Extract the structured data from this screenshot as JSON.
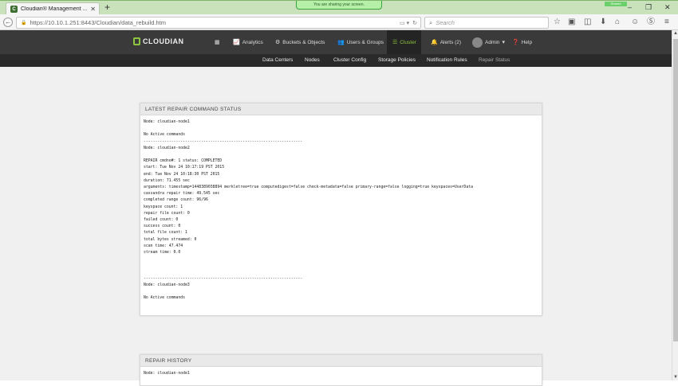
{
  "browser": {
    "tab_title": "Cloudian® Management ...",
    "tab_close": "✕",
    "new_tab": "+",
    "sharing_banner": "You are sharing your screen.",
    "shared_badge": "Shared",
    "url": "https://10.10.1.251:8443/Cloudian/data_rebuild.htm",
    "search_placeholder": "Search",
    "window_controls": [
      "–",
      "❐",
      "✕"
    ]
  },
  "app": {
    "logo": "CLOUDIAN",
    "nav": [
      {
        "label": "",
        "icon": "grid-icon"
      },
      {
        "label": "Analytics",
        "icon": "chart-icon"
      },
      {
        "label": "Buckets & Objects",
        "icon": "gear-icon"
      },
      {
        "label": "Users & Groups",
        "icon": "users-icon"
      },
      {
        "label": "Cluster",
        "icon": "cluster-icon",
        "active": true
      },
      {
        "label": "Alerts (2)",
        "icon": "bell-icon"
      },
      {
        "label": "Admin",
        "icon": "avatar"
      },
      {
        "label": "Help",
        "icon": "help-icon"
      }
    ],
    "subnav": [
      "Data Centers",
      "Nodes",
      "Cluster Config",
      "Storage Policies",
      "Notification Rules",
      "Repair Status"
    ],
    "subnav_active": "Repair Status"
  },
  "panels": {
    "latest": {
      "title": "LATEST REPAIR COMMAND STATUS",
      "lines": [
        "Node: cloudian-node1",
        "",
        "No Active commands",
        "---------------------------------------------------------------------",
        "Node: cloudian-node2",
        "",
        "REPAIR cmdno#: 1 status: COMPLETED",
        "start: Tue Nov 24 10:17:19 PST 2015",
        "end: Tue Nov 24 10:18:30 PST 2015",
        "duration: 71.455 sec",
        "arguments: timestamp=1448389038894 merkletree=true computedigest=false check-metadata=false primary-range=false logging=true keyspaces=UserData",
        "cassandra repair time: 49.545 sec",
        "completed range count: 96/96",
        "keyspace count: 1",
        "repair file count: 0",
        "failed count: 0",
        "success count: 0",
        "total file count: 1",
        "total bytes streamed: 0",
        "scan time: 47.474",
        "stream time: 0.0",
        "",
        "",
        "",
        "---------------------------------------------------------------------",
        "Node: cloudian-node3",
        "",
        "No Active commands"
      ]
    },
    "history": {
      "title": "REPAIR HISTORY",
      "lines": [
        "Node: cloudian-node1"
      ]
    }
  }
}
